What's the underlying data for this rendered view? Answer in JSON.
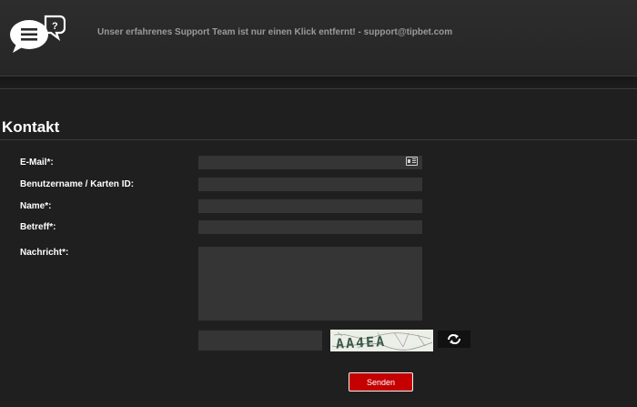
{
  "header": {
    "tagline": "Unser erfahrenes Support Team ist nur einen Klick entfernt! - support@tipbet.com",
    "logo_icon": "chat-bubbles-icon"
  },
  "page": {
    "title": "Kontakt"
  },
  "form": {
    "email_label": "E-Mail*:",
    "username_label": "Benutzername / Karten ID:",
    "name_label": "Name*:",
    "subject_label": "Betreff*:",
    "message_label": "Nachricht*:",
    "email_value": "",
    "username_value": "",
    "name_value": "",
    "subject_value": "",
    "message_value": "",
    "captcha_value": "",
    "captcha_text": "AA4EA",
    "send_label": "Senden"
  },
  "icons": {
    "email_field_icon": "contact-card-icon",
    "refresh_icon": "refresh-icon"
  },
  "colors": {
    "background": "#1f1f1f",
    "field": "#353535",
    "accent_red": "#c40000",
    "tagline": "#9a9a9a"
  }
}
